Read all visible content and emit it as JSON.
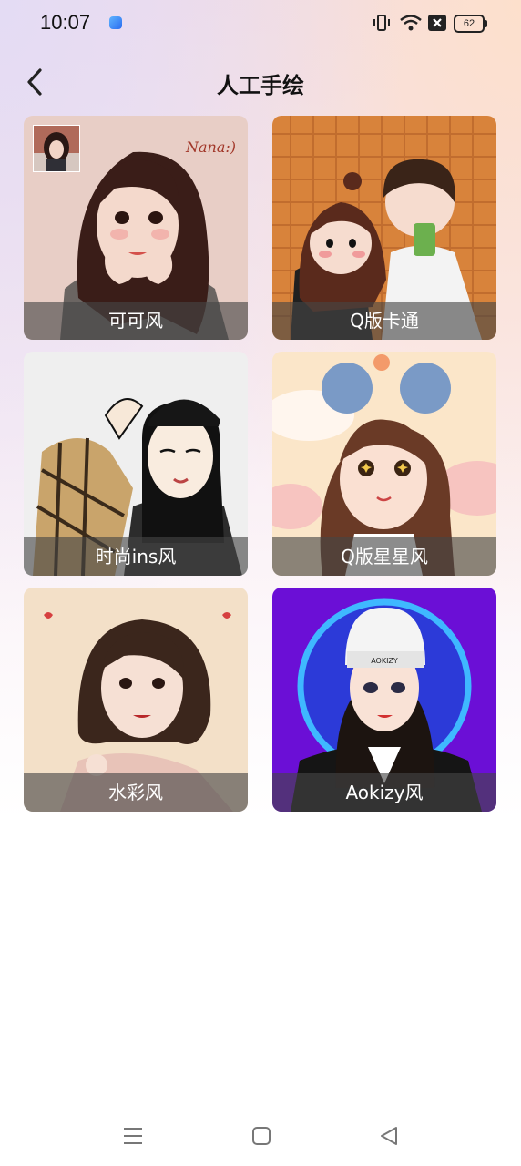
{
  "status": {
    "time": "10:07",
    "battery": "62"
  },
  "header": {
    "title": "人工手绘"
  },
  "styles": [
    {
      "label": "可可风",
      "signature": "Nana:)"
    },
    {
      "label": "Q版卡通"
    },
    {
      "label": "时尚ins风"
    },
    {
      "label": "Q版星星风"
    },
    {
      "label": "水彩风"
    },
    {
      "label": "Aokizy风",
      "hat_text": "AOKIZY"
    }
  ],
  "icons": {
    "back": "chevron-left-icon",
    "nav": [
      "menu-icon",
      "home-square-icon",
      "back-triangle-icon"
    ]
  }
}
